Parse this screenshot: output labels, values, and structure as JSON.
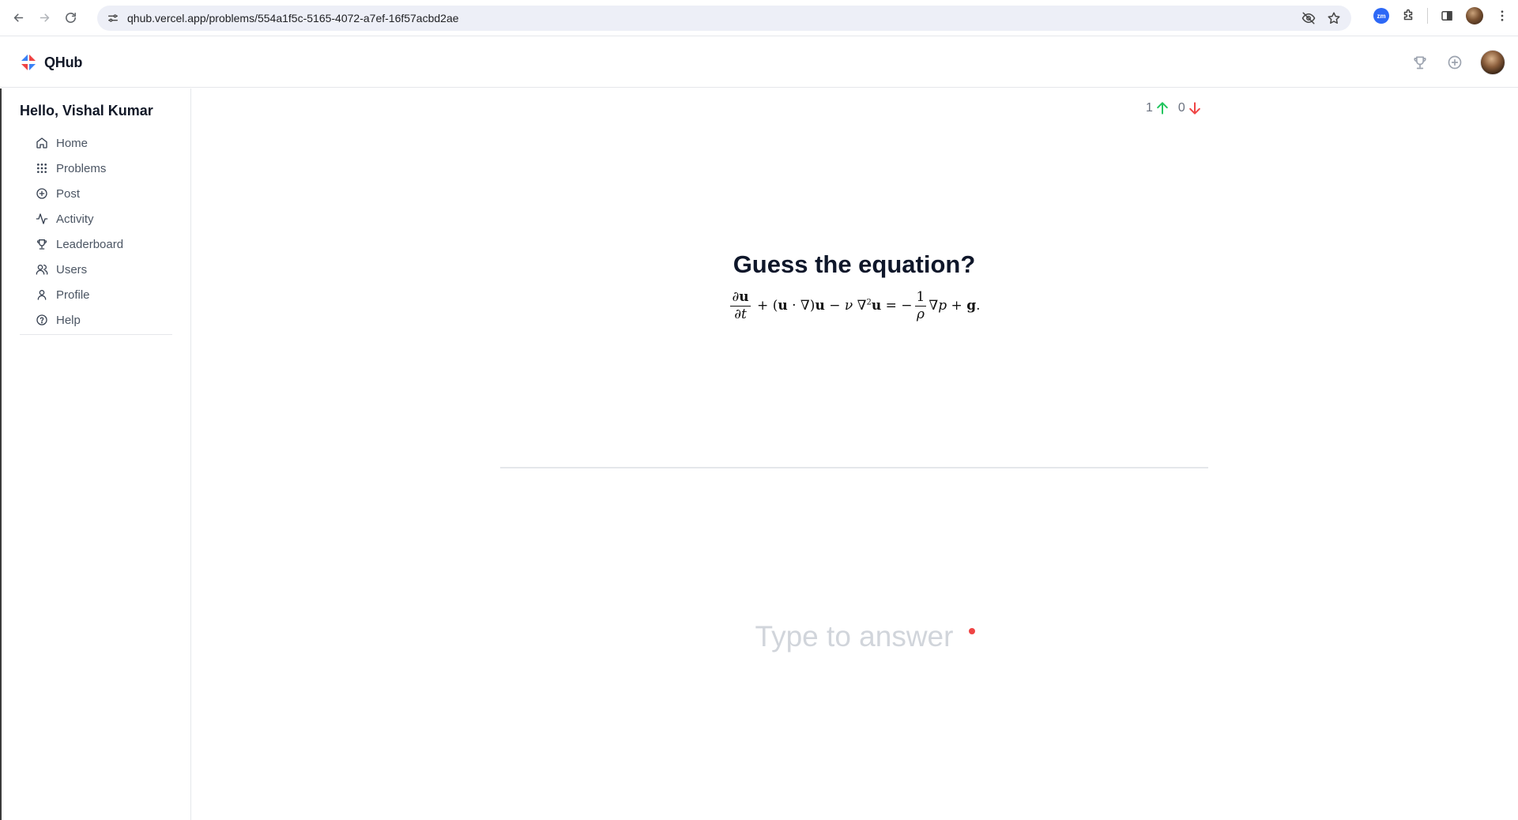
{
  "browser": {
    "url": "qhub.vercel.app/problems/554a1f5c-5165-4072-a7ef-16f57acbd2ae",
    "extension_label": "zm"
  },
  "header": {
    "brand": "QHub"
  },
  "sidebar": {
    "greeting": "Hello, Vishal Kumar",
    "items": [
      {
        "label": "Home",
        "icon": "home-icon"
      },
      {
        "label": "Problems",
        "icon": "grid-icon"
      },
      {
        "label": "Post",
        "icon": "plus-circle-icon"
      },
      {
        "label": "Activity",
        "icon": "activity-icon"
      },
      {
        "label": "Leaderboard",
        "icon": "trophy-icon"
      },
      {
        "label": "Users",
        "icon": "users-icon"
      },
      {
        "label": "Profile",
        "icon": "user-icon"
      },
      {
        "label": "Help",
        "icon": "help-circle-icon"
      }
    ]
  },
  "problem": {
    "upvotes": "1",
    "downvotes": "0",
    "title": "Guess the equation?",
    "equation_latex": "\\frac{\\partial \\mathbf{u}}{\\partial t} + (\\mathbf{u} \\cdot \\nabla)\\mathbf{u} - \\nu \\nabla^2 \\mathbf{u} = -\\frac{1}{\\rho}\\nabla p + \\mathbf{g}."
  },
  "answer": {
    "placeholder": "Type to answer",
    "value": ""
  },
  "colors": {
    "upvote": "#22c55e",
    "downvote": "#ef4444",
    "required_dot": "#ef4444"
  }
}
